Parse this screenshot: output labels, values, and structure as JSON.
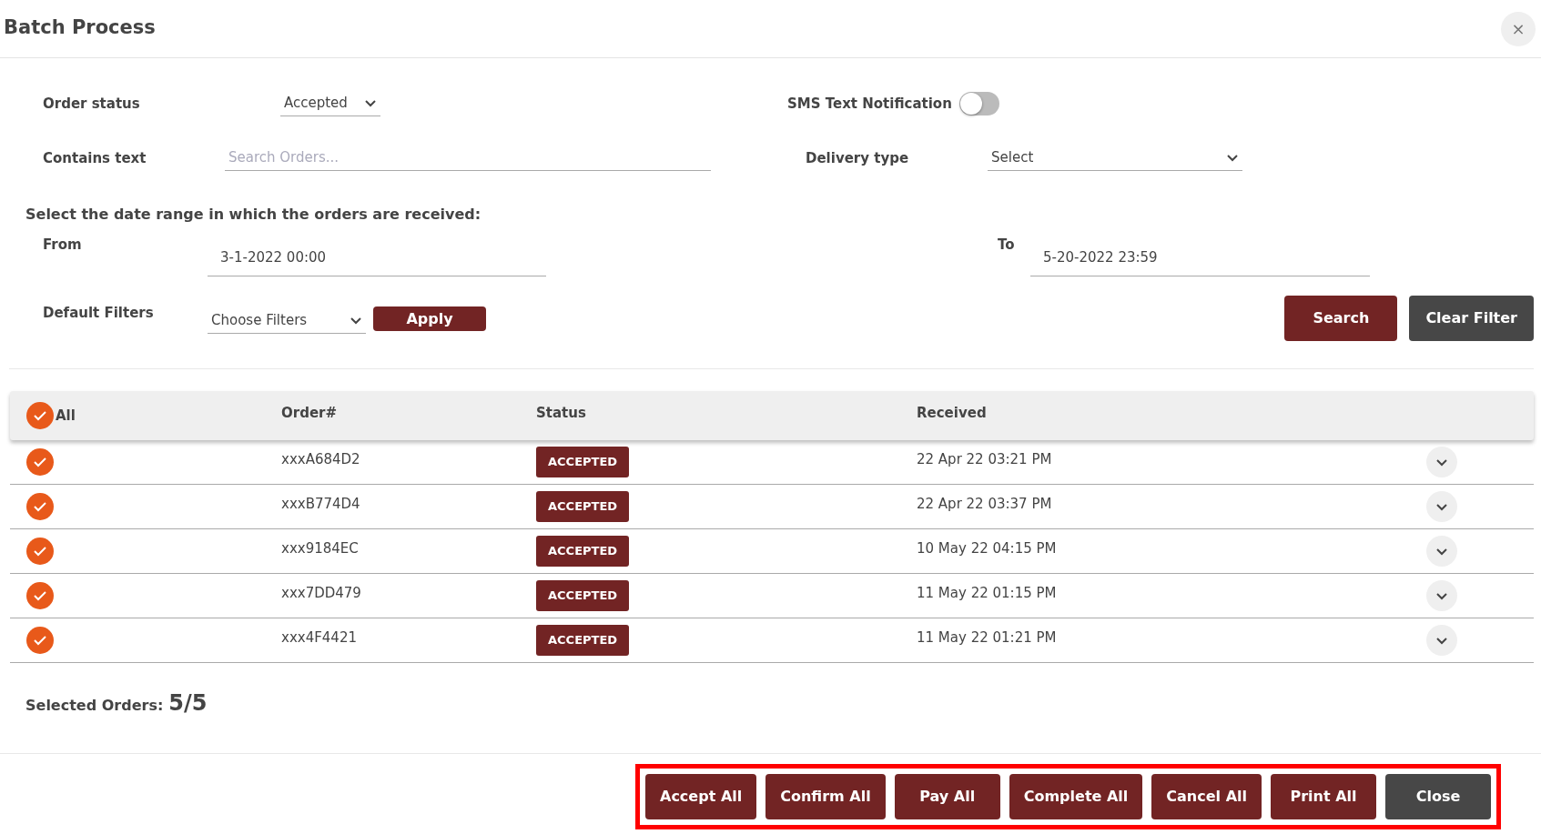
{
  "window": {
    "title": "Batch Process",
    "close": "×"
  },
  "filters": {
    "order_status": {
      "label": "Order status",
      "value": "Accepted"
    },
    "sms": {
      "label": "SMS Text Notification",
      "on": false
    },
    "contains_text": {
      "label": "Contains text",
      "placeholder": "Search Orders..."
    },
    "delivery_type": {
      "label": "Delivery type",
      "value": "Select"
    },
    "date_range": {
      "prompt": "Select the date range in which the orders are received:",
      "from_label": "From",
      "from": "3-1-2022 00:00",
      "to_label": "To",
      "to": "5-20-2022 23:59"
    },
    "default_filters": {
      "label": "Default Filters",
      "value": "Choose Filters",
      "apply": "Apply"
    },
    "buttons": [
      {
        "label": "Search",
        "kind": "primary"
      },
      {
        "label": "Clear Filter",
        "kind": "secondary"
      }
    ]
  },
  "table": {
    "select_all": {
      "label": "All",
      "checked": true
    },
    "columns": [
      "Order#",
      "Status",
      "Received"
    ],
    "rows": [
      {
        "checked": true,
        "order": "xxxA684D2",
        "status": "ACCEPTED",
        "received": "22 Apr 22 03:21 PM"
      },
      {
        "checked": true,
        "order": "xxxB774D4",
        "status": "ACCEPTED",
        "received": "22 Apr 22 03:37 PM"
      },
      {
        "checked": true,
        "order": "xxx9184EC",
        "status": "ACCEPTED",
        "received": "10 May 22 04:15 PM"
      },
      {
        "checked": true,
        "order": "xxx7DD479",
        "status": "ACCEPTED",
        "received": "11 May 22 01:15 PM"
      },
      {
        "checked": true,
        "order": "xxx4F4421",
        "status": "ACCEPTED",
        "received": "11 May 22 01:21 PM"
      }
    ]
  },
  "selected_orders": {
    "label": "Selected Orders:",
    "count": "5/5"
  },
  "footer_buttons": [
    {
      "label": "Accept All",
      "kind": "primary"
    },
    {
      "label": "Confirm All",
      "kind": "primary"
    },
    {
      "label": "Pay All",
      "kind": "primary"
    },
    {
      "label": "Complete All",
      "kind": "primary"
    },
    {
      "label": "Cancel All",
      "kind": "primary"
    },
    {
      "label": "Print All",
      "kind": "primary"
    },
    {
      "label": "Close",
      "kind": "secondary"
    }
  ]
}
